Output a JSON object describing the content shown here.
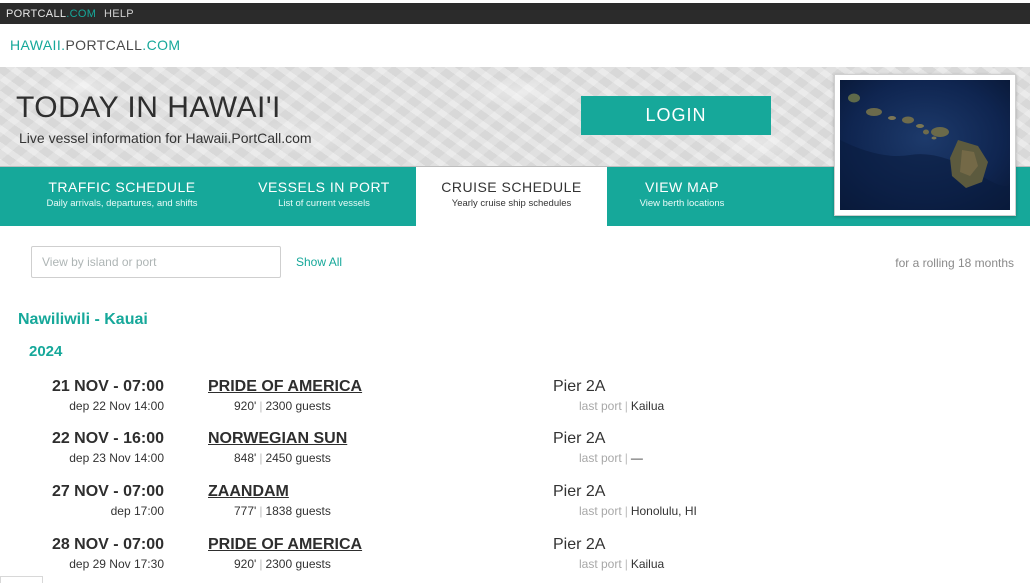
{
  "topbar": {
    "portcall": "PORTCALL",
    "portcall_dom": ".COM",
    "help": "HELP"
  },
  "brand": {
    "pre": "HAWAII.",
    "mid": "PORTCALL",
    "post": ".COM"
  },
  "hero": {
    "title": "TODAY IN HAWAI'I",
    "subtitle": "Live vessel information for Hawaii.PortCall.com",
    "login_label": "LOGIN"
  },
  "tabs": [
    {
      "title": "TRAFFIC SCHEDULE",
      "subtitle": "Daily arrivals, departures, and shifts"
    },
    {
      "title": "VESSELS IN PORT",
      "subtitle": "List of current vessels"
    },
    {
      "title": "CRUISE SCHEDULE",
      "subtitle": "Yearly cruise ship schedules"
    },
    {
      "title": "VIEW MAP",
      "subtitle": "View berth locations"
    }
  ],
  "filter": {
    "placeholder": "View by island or port",
    "show_all": "Show All",
    "rolling": "for a rolling 18 months"
  },
  "port": {
    "name": "Nawiliwili - Kauai",
    "year": "2024"
  },
  "schedule": [
    {
      "arrival": "21 NOV - 07:00",
      "departure": "dep 22 Nov 14:00",
      "ship": "PRIDE OF AMERICA",
      "length": "920'",
      "guests": "2300 guests",
      "pier": "Pier 2A",
      "last_port_label": "last port",
      "last_port": "Kailua"
    },
    {
      "arrival": "22 NOV - 16:00",
      "departure": "dep 23 Nov 14:00",
      "ship": "NORWEGIAN SUN",
      "length": "848'",
      "guests": "2450 guests",
      "pier": "Pier 2A",
      "last_port_label": "last port",
      "last_port": "—"
    },
    {
      "arrival": "27 NOV - 07:00",
      "departure": "dep 17:00",
      "ship": "ZAANDAM",
      "length": "777'",
      "guests": "1838 guests",
      "pier": "Pier 2A",
      "last_port_label": "last port",
      "last_port": "Honolulu, HI"
    },
    {
      "arrival": "28 NOV - 07:00",
      "departure": "dep 29 Nov 17:30",
      "ship": "PRIDE OF AMERICA",
      "length": "920'",
      "guests": "2300 guests",
      "pier": "Pier 2A",
      "last_port_label": "last port",
      "last_port": "Kailua"
    }
  ],
  "colors": {
    "accent": "#16a89a",
    "topbar": "#2b2b2b",
    "text": "#2e2e2e"
  }
}
